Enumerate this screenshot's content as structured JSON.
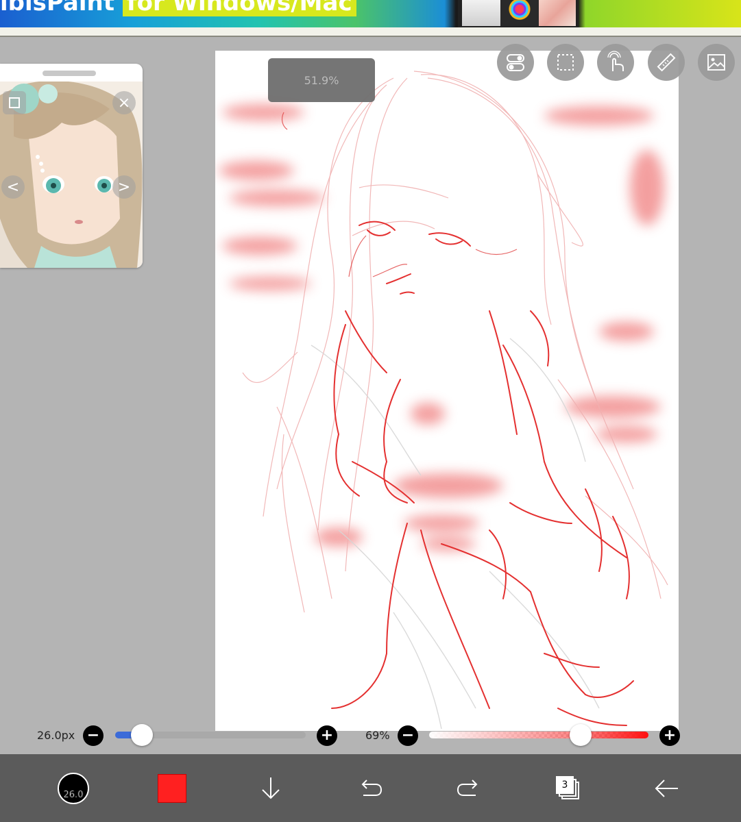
{
  "ad_banner": {
    "text_prefix": "ibisPaint",
    "text_highlight": "for Windows/Mac"
  },
  "canvas": {
    "zoom_label": "51.9%"
  },
  "toolbar_top": {
    "items": [
      {
        "name": "toggle-icon"
      },
      {
        "name": "selection-icon"
      },
      {
        "name": "touch-gesture-icon"
      },
      {
        "name": "ruler-icon"
      },
      {
        "name": "image-icon"
      }
    ]
  },
  "reference_window": {
    "close_glyph": "×",
    "prev_glyph": "<",
    "next_glyph": ">"
  },
  "brush_size": {
    "label": "26.0px",
    "fraction": 0.14,
    "minus": "−",
    "plus": "+"
  },
  "opacity": {
    "label": "69%",
    "fraction": 0.69,
    "minus": "−",
    "plus": "+"
  },
  "bottom_bar": {
    "brush_size_badge": "26.0",
    "current_color": "#ff2020",
    "layers_count": "3"
  },
  "colors": {
    "background": "#b4b4b4",
    "bar": "#5b5b5b",
    "accent_blue": "#3b6bd8",
    "sketch_red": "#e02020"
  }
}
